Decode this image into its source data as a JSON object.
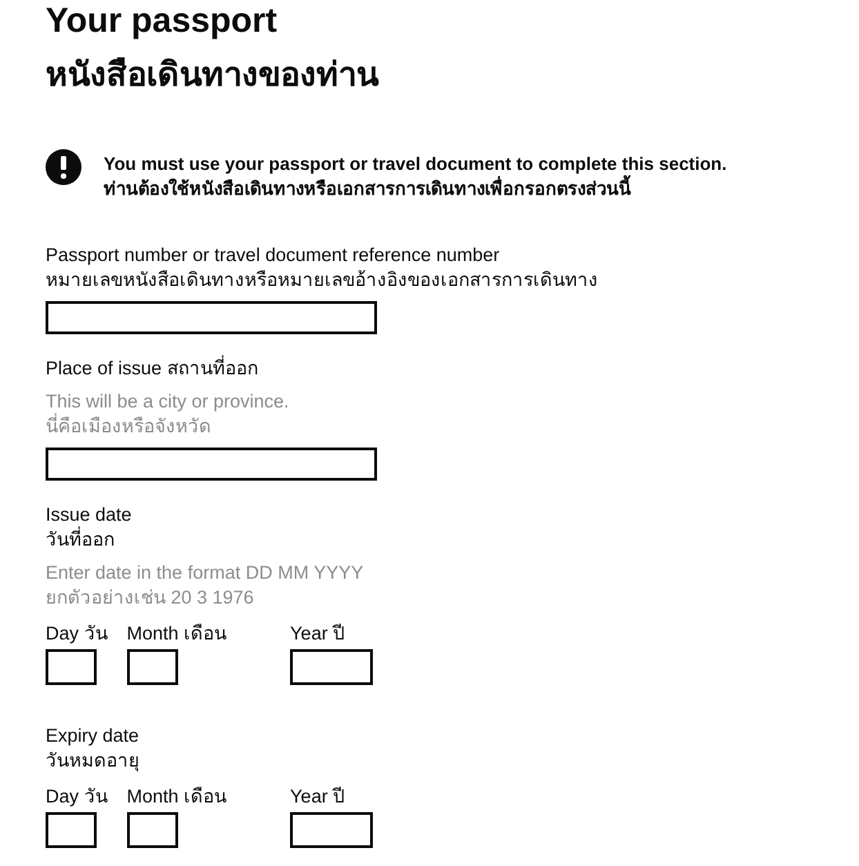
{
  "heading": {
    "title": "Your passport",
    "subtitle": "หนังสือเดินทางของท่าน"
  },
  "warning": {
    "lines": [
      "You must use your passport or travel document to complete this section.",
      "ท่านต้องใช้หนังสือเดินทางหรือเอกสารการเดินทางเพื่อกรอกตรงส่วนนี้"
    ]
  },
  "fields": [
    {
      "kind": "text",
      "label": [
        "Passport number or travel document reference number",
        "หมายเลขหนังสือเดินทางหรือหมายเลขอ้างอิงของเอกสารการเดินทาง"
      ]
    },
    {
      "kind": "text",
      "label": [
        "Place of issue สถานที่ออก"
      ],
      "hint": [
        "This will be a city or province.",
        "นี่คือเมืองหรือจังหวัด"
      ]
    },
    {
      "kind": "date",
      "label": [
        "Issue date",
        "วันที่ออก"
      ],
      "hint": [
        "Enter date in the format DD MM YYYY",
        "ยกตัวอย่างเช่น 20 3 1976"
      ],
      "parts": [
        {
          "kind": "day",
          "label": "Day วัน"
        },
        {
          "kind": "month",
          "label": "Month เดือน"
        },
        {
          "kind": "year",
          "label": "Year ปี"
        }
      ]
    },
    {
      "kind": "date",
      "label": [
        "Expiry date",
        "วันหมดอายุ"
      ],
      "parts": [
        {
          "kind": "day",
          "label": "Day วัน"
        },
        {
          "kind": "month",
          "label": "Month เดือน"
        },
        {
          "kind": "year",
          "label": "Year ปี"
        }
      ]
    }
  ]
}
